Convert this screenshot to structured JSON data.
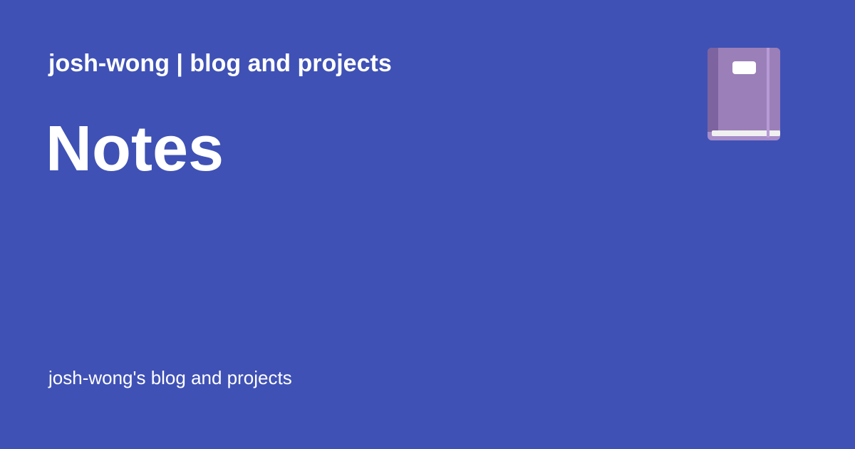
{
  "header": {
    "site_title": "josh-wong | blog and projects"
  },
  "main": {
    "page_title": "Notes",
    "icon": "notebook-icon"
  },
  "footer": {
    "description": "josh-wong's blog and projects"
  },
  "colors": {
    "background": "#3f51b5",
    "text": "#ffffff",
    "book_cover": "#9b7fb8",
    "book_spine": "#7d63a0",
    "book_pages": "#f0f0f0"
  }
}
